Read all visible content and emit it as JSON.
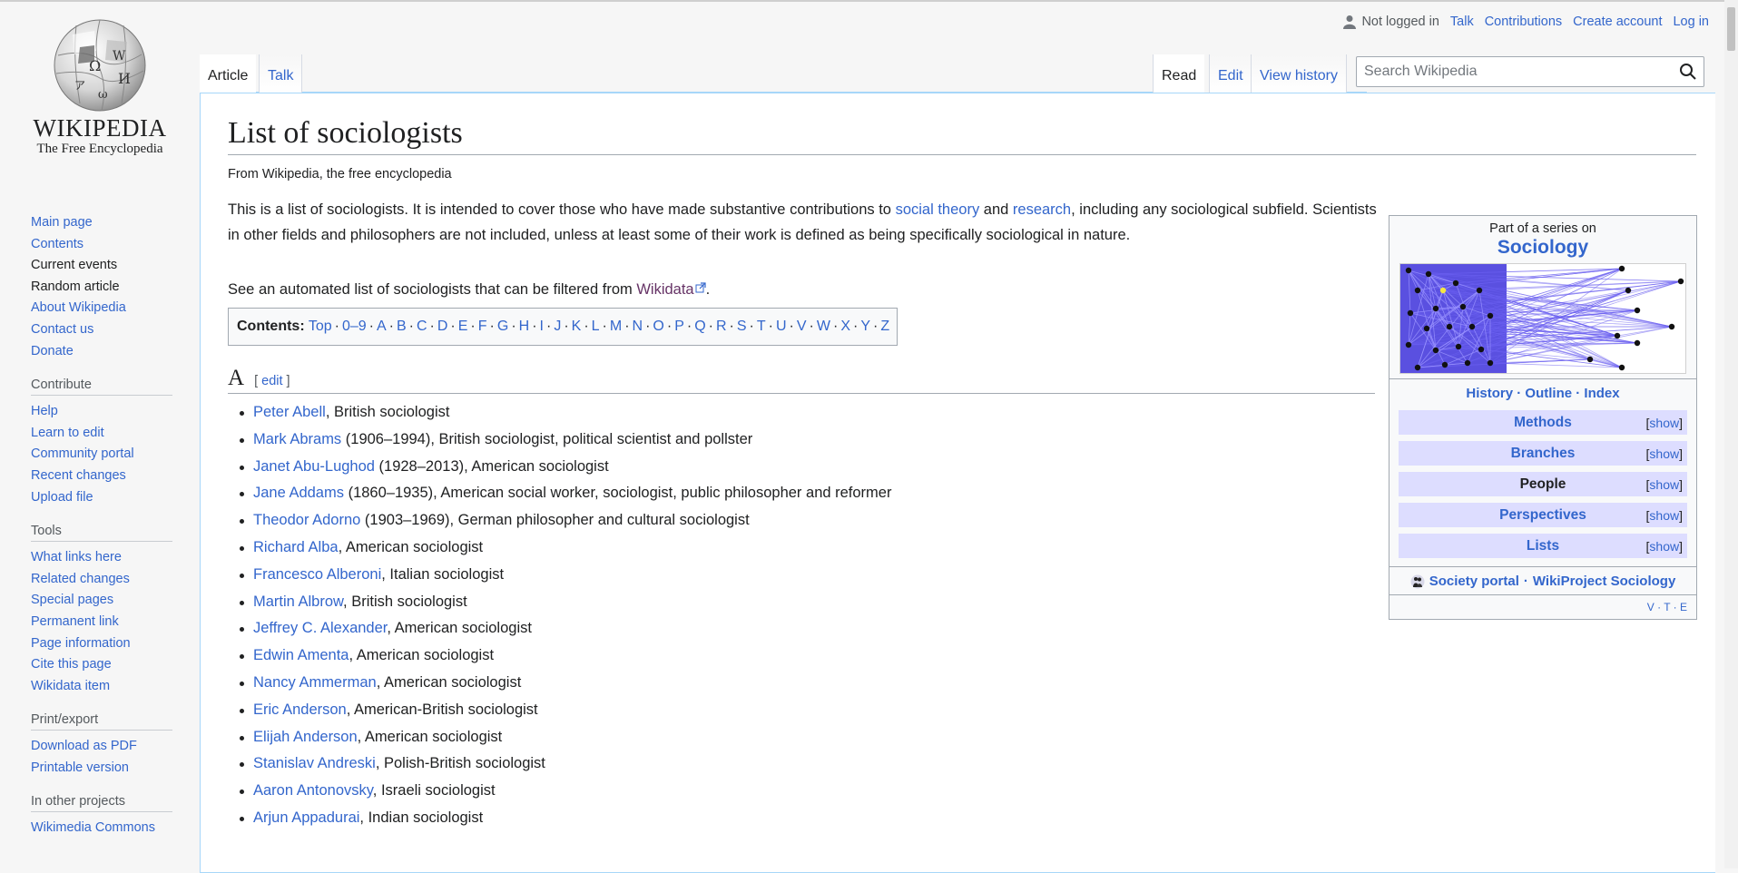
{
  "logo": {
    "wordmark": "Wikipedia",
    "tagline": "The Free Encyclopedia"
  },
  "nav": {
    "main": [
      "Main page",
      "Contents",
      "Current events",
      "Random article",
      "About Wikipedia",
      "Contact us",
      "Donate"
    ],
    "contribute_head": "Contribute",
    "contribute": [
      "Help",
      "Learn to edit",
      "Community portal",
      "Recent changes",
      "Upload file"
    ],
    "tools_head": "Tools",
    "tools": [
      "What links here",
      "Related changes",
      "Special pages",
      "Permanent link",
      "Page information",
      "Cite this page",
      "Wikidata item"
    ],
    "print_head": "Print/export",
    "print": [
      "Download as PDF",
      "Printable version"
    ],
    "projects_head": "In other projects",
    "projects": [
      "Wikimedia Commons"
    ]
  },
  "personal": {
    "not_logged": "Not logged in",
    "talk": "Talk",
    "contributions": "Contributions",
    "create": "Create account",
    "login": "Log in"
  },
  "tabs": {
    "article": "Article",
    "talk": "Talk",
    "read": "Read",
    "edit": "Edit",
    "history": "View history"
  },
  "search": {
    "placeholder": "Search Wikipedia"
  },
  "page": {
    "title": "List of sociologists",
    "site_sub": "From Wikipedia, the free encyclopedia",
    "lead_1": "This is a list of sociologists. It is intended to cover those who have made substantive contributions to ",
    "lead_link1": "social theory",
    "lead_2": " and ",
    "lead_link2": "research",
    "lead_3": ", including any sociological subfield. Scientists in other fields and philosophers are not included, unless at least some of their work is defined as being specifically sociological in nature.",
    "wd_text": "See an automated list of sociologists that can be filtered from ",
    "wd_link": "Wikidata",
    "wd_end": "."
  },
  "toc": {
    "label": "Contents:",
    "items": [
      "Top",
      "0–9",
      "A",
      "B",
      "C",
      "D",
      "E",
      "F",
      "G",
      "H",
      "I",
      "J",
      "K",
      "L",
      "M",
      "N",
      "O",
      "P",
      "Q",
      "R",
      "S",
      "T",
      "U",
      "V",
      "W",
      "X",
      "Y",
      "Z"
    ]
  },
  "section": {
    "letter": "A",
    "edit": "edit",
    "bracket_open": "[ ",
    "bracket_close": " ]"
  },
  "entries": [
    {
      "name": "Peter Abell",
      "desc": ", British sociologist"
    },
    {
      "name": "Mark Abrams",
      "desc": " (1906–1994), British sociologist, political scientist and pollster"
    },
    {
      "name": "Janet Abu-Lughod",
      "desc": " (1928–2013), American sociologist"
    },
    {
      "name": "Jane Addams",
      "desc": " (1860–1935), American social worker, sociologist, public philosopher and reformer"
    },
    {
      "name": "Theodor Adorno",
      "desc": " (1903–1969), German philosopher and cultural sociologist"
    },
    {
      "name": "Richard Alba",
      "desc": ", American sociologist"
    },
    {
      "name": "Francesco Alberoni",
      "desc": ", Italian sociologist"
    },
    {
      "name": "Martin Albrow",
      "desc": ", British sociologist"
    },
    {
      "name": "Jeffrey C. Alexander",
      "desc": ", American sociologist"
    },
    {
      "name": "Edwin Amenta",
      "desc": ", American sociologist"
    },
    {
      "name": "Nancy Ammerman",
      "desc": ", American sociologist"
    },
    {
      "name": "Eric Anderson",
      "desc": ", American-British sociologist"
    },
    {
      "name": "Elijah Anderson",
      "desc": ", American sociologist"
    },
    {
      "name": "Stanislav Andreski",
      "desc": ", Polish-British sociologist"
    },
    {
      "name": "Aaron Antonovsky",
      "desc": ", Israeli sociologist"
    },
    {
      "name": "Arjun Appadurai",
      "desc": ", Indian sociologist"
    }
  ],
  "infobox": {
    "above": "Part of a series on",
    "title": "Sociology",
    "links": [
      "History",
      "Outline",
      "Index"
    ],
    "rows": [
      {
        "label": "Methods",
        "show": "show",
        "link": true
      },
      {
        "label": "Branches",
        "show": "show",
        "link": true
      },
      {
        "label": "People",
        "show": "show",
        "link": false
      },
      {
        "label": "Perspectives",
        "show": "show",
        "link": true
      },
      {
        "label": "Lists",
        "show": "show",
        "link": true
      }
    ],
    "portal": "Society portal",
    "project": "WikiProject Sociology",
    "dot": " · ",
    "vte": [
      "V",
      "T",
      "E"
    ]
  },
  "colors": {
    "link": "#3366cc",
    "visited": "#663366",
    "text": "#202122",
    "infobox_row": "#ddddff",
    "border": "#a7d7f9"
  }
}
